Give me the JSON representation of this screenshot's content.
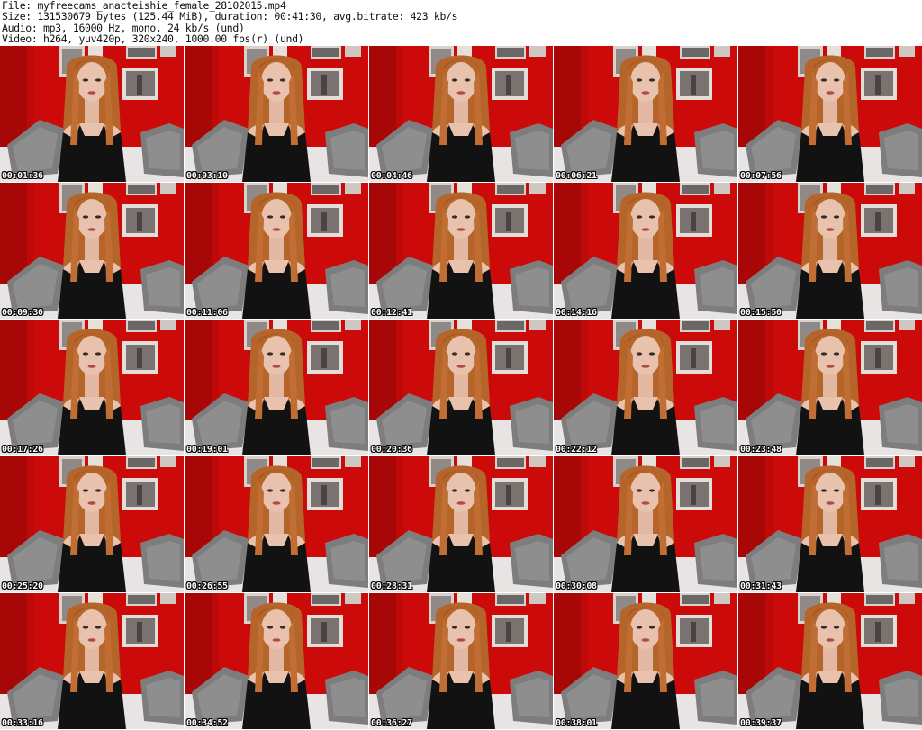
{
  "header": {
    "lines": [
      "File: myfreecams_anacteishie_female_28102015.mp4",
      "Size: 131530679 bytes (125.44 MiB), duration: 00:41:30, avg.bitrate: 423 kb/s",
      "Audio: mp3, 16000 Hz, mono, 24 kb/s (und)",
      "Video: h264, yuv420p, 320x240, 1000.00 fps(r) (und)"
    ]
  },
  "thumbnails": [
    {
      "timestamp": "00:01:36"
    },
    {
      "timestamp": "00:03:10"
    },
    {
      "timestamp": "00:04:46"
    },
    {
      "timestamp": "00:06:21"
    },
    {
      "timestamp": "00:07:56"
    },
    {
      "timestamp": "00:09:30"
    },
    {
      "timestamp": "00:11:06"
    },
    {
      "timestamp": "00:12:41"
    },
    {
      "timestamp": "00:14:16"
    },
    {
      "timestamp": "00:15:50"
    },
    {
      "timestamp": "00:17:26"
    },
    {
      "timestamp": "00:19:01"
    },
    {
      "timestamp": "00:20:36"
    },
    {
      "timestamp": "00:22:12"
    },
    {
      "timestamp": "00:23:48"
    },
    {
      "timestamp": "00:25:20"
    },
    {
      "timestamp": "00:26:55"
    },
    {
      "timestamp": "00:28:31"
    },
    {
      "timestamp": "00:30:08"
    },
    {
      "timestamp": "00:31:43"
    },
    {
      "timestamp": "00:33:16"
    },
    {
      "timestamp": "00:34:52"
    },
    {
      "timestamp": "00:36:27"
    },
    {
      "timestamp": "00:38:01"
    },
    {
      "timestamp": "00:39:37"
    }
  ],
  "colors": {
    "wall_red": "#cc0a0a",
    "wall_dark_red": "#9e0606",
    "hair": "#b5642a",
    "skin": "#e9c2ad",
    "top_black": "#121212",
    "pillow_gray": "#7d7d7d",
    "sofa_white": "#e8e4e4"
  }
}
